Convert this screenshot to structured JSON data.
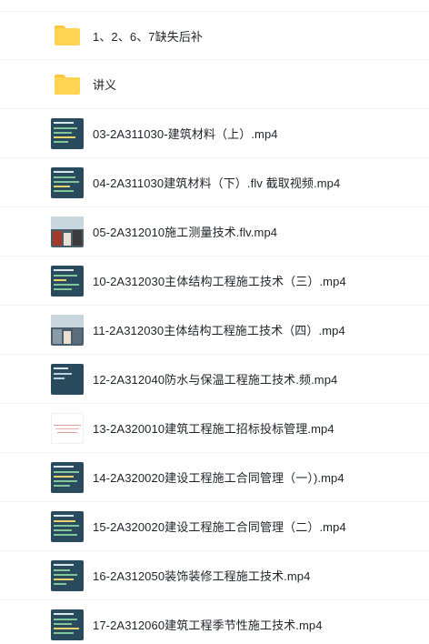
{
  "files": [
    {
      "name": "1、2、6、7缺失后补",
      "type": "folder",
      "icon": "folder-icon"
    },
    {
      "name": "讲义",
      "type": "folder",
      "icon": "folder-icon"
    },
    {
      "name": "03-2A311030-建筑材料（上）.mp4",
      "type": "video",
      "icon": "video-thumbnail"
    },
    {
      "name": "04-2A311030建筑材料（下）.flv 截取视频.mp4",
      "type": "video",
      "icon": "video-thumbnail"
    },
    {
      "name": "05-2A312010施工测量技术.flv.mp4",
      "type": "video",
      "icon": "video-thumbnail"
    },
    {
      "name": "10-2A312030主体结构工程施工技术（三）.mp4",
      "type": "video",
      "icon": "video-thumbnail"
    },
    {
      "name": "11-2A312030主体结构工程施工技术（四）.mp4",
      "type": "video",
      "icon": "video-thumbnail"
    },
    {
      "name": "12-2A312040防水与保温工程施工技术.频.mp4",
      "type": "video",
      "icon": "video-thumbnail"
    },
    {
      "name": "13-2A320010建筑工程施工招标投标管理.mp4",
      "type": "video",
      "icon": "video-thumbnail"
    },
    {
      "name": "14-2A320020建设工程施工合同管理（一）).mp4",
      "type": "video",
      "icon": "video-thumbnail"
    },
    {
      "name": "15-2A320020建设工程施工合同管理（二）.mp4",
      "type": "video",
      "icon": "video-thumbnail"
    },
    {
      "name": "16-2A312050装饰装修工程施工技术.mp4",
      "type": "video",
      "icon": "video-thumbnail"
    },
    {
      "name": "17-2A312060建筑工程季节性施工技术.mp4",
      "type": "video",
      "icon": "video-thumbnail"
    }
  ]
}
